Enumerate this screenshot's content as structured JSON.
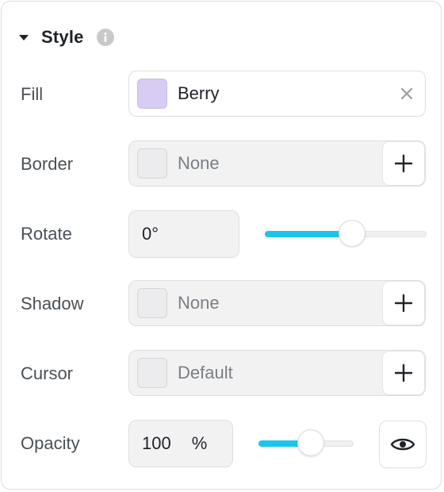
{
  "section": {
    "title": "Style",
    "expanded": true
  },
  "rows": {
    "fill": {
      "label": "Fill",
      "value": "Berry",
      "swatch_color": "#d9ccf2"
    },
    "border": {
      "label": "Border",
      "value": "None"
    },
    "rotate": {
      "label": "Rotate",
      "value": "0°",
      "slider_level": 0.54
    },
    "shadow": {
      "label": "Shadow",
      "value": "None"
    },
    "cursor": {
      "label": "Cursor",
      "value": "Default"
    },
    "opacity": {
      "label": "Opacity",
      "value": "100",
      "unit": "%",
      "slider_level": 0.55
    }
  },
  "icons": {
    "caret": "caret-down-icon",
    "info": "info-icon",
    "clear": "close-icon",
    "add": "plus-icon",
    "visibility": "eye-icon"
  },
  "colors": {
    "accent": "#1bc5ea",
    "berry": "#d9ccf2"
  }
}
